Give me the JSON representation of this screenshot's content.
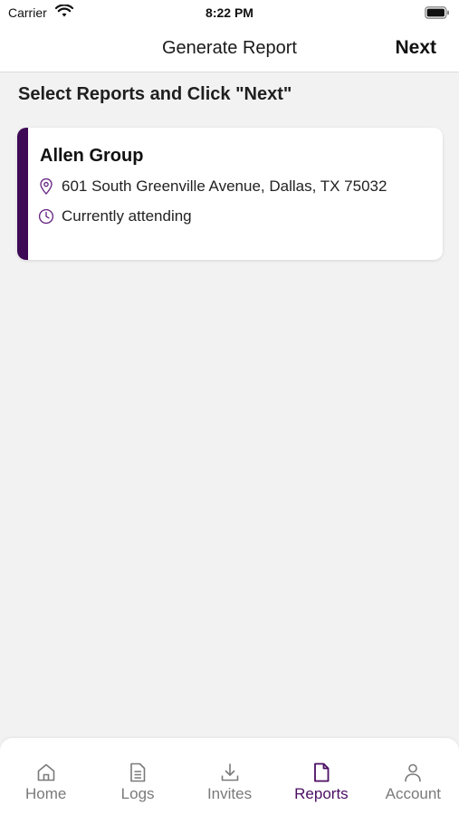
{
  "status_bar": {
    "carrier": "Carrier",
    "time": "8:22 PM",
    "icons": [
      "wifi-icon",
      "battery-icon"
    ]
  },
  "nav": {
    "title": "Generate Report",
    "next_label": "Next"
  },
  "instruction": "Select Reports and Click \"Next\"",
  "report": {
    "name": "Allen Group",
    "address": "601 South Greenville Avenue, Dallas, TX 75032",
    "status": "Currently attending",
    "icons": [
      "location-pin-icon",
      "clock-icon"
    ],
    "accent_color": "#3d0a55"
  },
  "tabs": [
    {
      "label": "Home",
      "icon": "home-icon",
      "active": false
    },
    {
      "label": "Logs",
      "icon": "document-lines-icon",
      "active": false
    },
    {
      "label": "Invites",
      "icon": "download-icon",
      "active": false
    },
    {
      "label": "Reports",
      "icon": "file-icon",
      "active": true
    },
    {
      "label": "Account",
      "icon": "person-icon",
      "active": false
    }
  ],
  "colors": {
    "active_tab": "#4b0e63",
    "inactive_tab": "#7a7a7a",
    "background": "#f2f2f2"
  }
}
